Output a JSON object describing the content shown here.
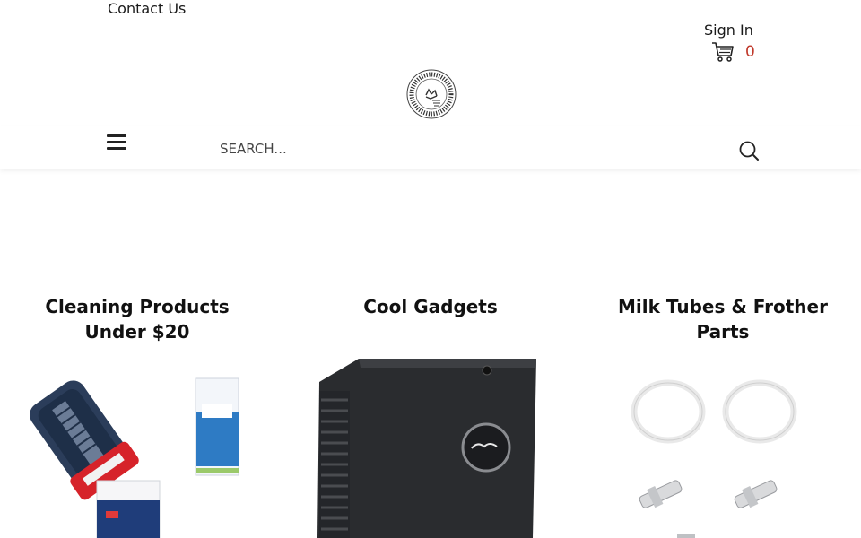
{
  "topbar": {
    "contact_label": "Contact Us",
    "signin_label": "Sign In",
    "cart_count": "0"
  },
  "search": {
    "placeholder": "SEARCH..."
  },
  "categories": [
    {
      "title": "Cleaning Products Under $20"
    },
    {
      "title": "Cool Gadgets"
    },
    {
      "title": "Milk Tubes & Frother Parts"
    }
  ],
  "colors": {
    "cart_count": "#c0392b",
    "text": "#1a1a1a"
  },
  "icons": {
    "cart": "shopping-cart-icon",
    "search": "magnifier-icon",
    "menu": "hamburger-menu-icon"
  }
}
